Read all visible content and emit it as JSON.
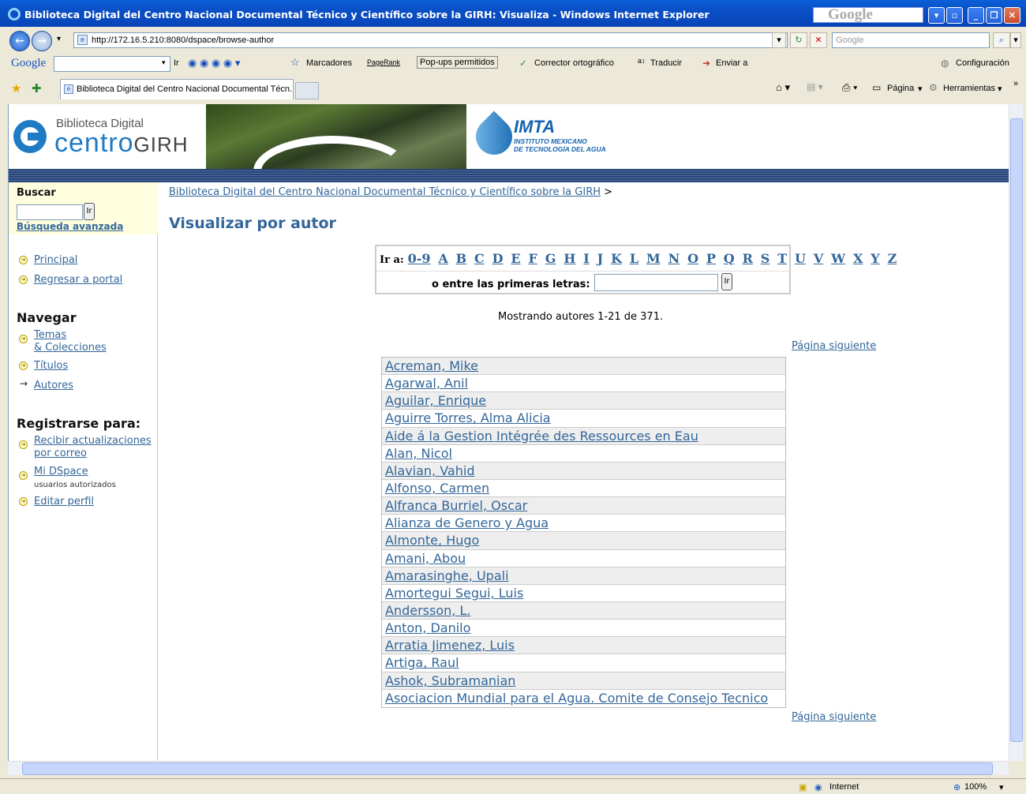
{
  "window": {
    "title": "Biblioteca Digital del Centro Nacional Documental Técnico y Científico sobre la GIRH: Visualiza - Windows Internet Explorer",
    "google_box": "Google"
  },
  "address_bar": {
    "url": "http://172.16.5.210:8080/dspace/browse-author",
    "search_placeholder": "Google"
  },
  "google_toolbar": {
    "logo": "Google",
    "ir": "Ir",
    "marcadores": "Marcadores",
    "pagerank": "PageRank",
    "popups": "Pop-ups permitidos",
    "corrector": "Corrector ortográfico",
    "traducir": "Traducir",
    "enviar": "Enviar a",
    "config": "Configuración"
  },
  "tabs": {
    "active_tab": "Biblioteca Digital del Centro Nacional Documental Técn...",
    "pagina": "Página",
    "herramientas": "Herramientas"
  },
  "header": {
    "logo_line1": "Biblioteca Digital",
    "logo_centro": "centro",
    "logo_girh": "GIRH",
    "imta_name": "IMTA",
    "imta_sub1": "INSTITUTO MEXICANO",
    "imta_sub2": "DE TECNOLOGÍA DEL AGUA"
  },
  "sidebar": {
    "buscar": "Buscar",
    "ir": "Ir",
    "busqueda_avanzada": "Búsqueda avanzada",
    "principal": "Principal",
    "regresar": "Regresar a portal",
    "navegar": "Navegar",
    "temas": "Temas",
    "colecciones": "& Colecciones",
    "titulos": "Títulos",
    "autores": "Autores",
    "registrarse": "Registrarse para:",
    "recibir1": "Recibir actualizaciones",
    "recibir2": "por correo",
    "midspace": "Mi DSpace",
    "usuarios": "usuarios autorizados",
    "editar": "Editar perfil"
  },
  "main": {
    "breadcrumb": "Biblioteca Digital del Centro Nacional Documental Técnico y Científico sobre la GIRH",
    "breadcrumb_sep": ">",
    "title": "Visualizar por autor",
    "ir_a": "Ir a:",
    "letters": [
      "0-9",
      "A",
      "B",
      "C",
      "D",
      "E",
      "F",
      "G",
      "H",
      "I",
      "J",
      "K",
      "L",
      "M",
      "N",
      "O",
      "P",
      "Q",
      "R",
      "S",
      "T",
      "U",
      "V",
      "W",
      "X",
      "Y",
      "Z"
    ],
    "primeras_letras": "o entre las primeras letras:",
    "ir_button": "Ir",
    "showing": "Mostrando autores 1-21 de 371.",
    "next_top": "Página siguiente",
    "next_bottom": "Página siguiente",
    "authors": [
      "Acreman, Mike",
      "Agarwal, Anil",
      "Aguilar, Enrique",
      "Aguirre Torres, Alma Alicia",
      "Aide á la Gestion Intégrée des Ressources en Eau",
      "Alan, Nicol",
      "Alavian, Vahid",
      "Alfonso, Carmen",
      "Alfranca Burriel, Oscar",
      "Alianza de Genero y Agua",
      "Almonte, Hugo",
      "Amani, Abou",
      "Amarasinghe, Upali",
      "Amortegui Segui, Luis",
      "Andersson, L.",
      "Anton, Danilo",
      "Arratia Jimenez, Luis",
      "Artiga, Raul",
      "Ashok, Subramanian",
      "Asociacion Mundial para el Agua. Comite de Consejo Tecnico"
    ]
  },
  "statusbar": {
    "zone": "Internet",
    "zoom": "100%"
  }
}
